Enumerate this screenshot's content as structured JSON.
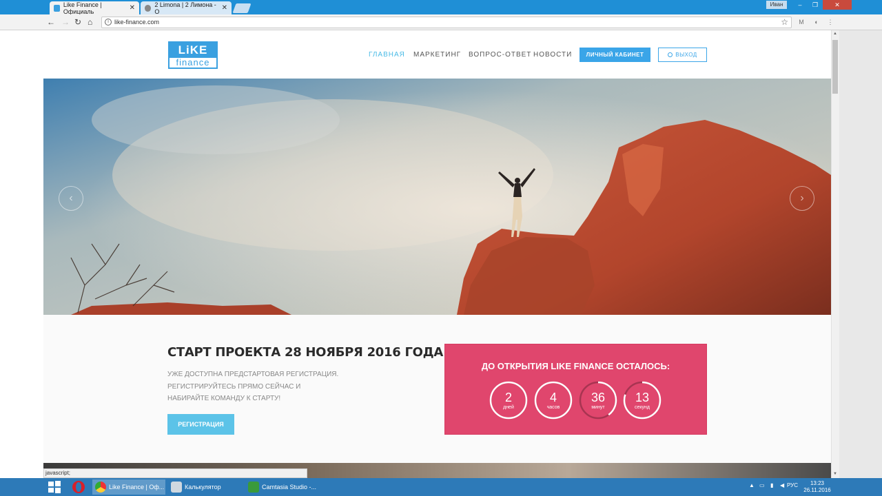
{
  "browser": {
    "tabs": [
      {
        "title": "Like Finance | Официаль",
        "active": true
      },
      {
        "title": "2 Limona | 2 Лимона - О",
        "active": false
      }
    ],
    "user_badge": "Иван",
    "url": "like-finance.com"
  },
  "site": {
    "logo_top": "LiKE",
    "logo_bottom": "finance",
    "nav": [
      "ГЛАВНАЯ",
      "МАРКЕТИНГ",
      "ВОПРОС-ОТВЕТ",
      "НОВОСТИ"
    ],
    "cabinet_label": "ЛИЧНЫЙ КАБИНЕТ",
    "logout_label": "ВЫХОД",
    "accent": "#3aa5e8",
    "nav_active_color": "#4bbbe6"
  },
  "hero": {
    "prev_icon": "chevron-left-icon",
    "next_icon": "chevron-right-icon"
  },
  "start": {
    "title": "СТАРТ ПРОЕКТА 28 НОЯБРЯ 2016 ГОДА",
    "lines": [
      "УЖЕ ДОСТУПНА ПРЕДСТАРТОВАЯ РЕГИСТРАЦИЯ.",
      "РЕГИСТРИРУЙТЕСЬ ПРЯМО СЕЙЧАС И",
      "НАБИРАЙТЕ КОМАНДУ К СТАРТУ!"
    ],
    "register_label": "РЕГИСТРАЦИЯ"
  },
  "countdown": {
    "title": "ДО ОТКРЫТИЯ LIKE FINANCE ОСТАЛОСЬ:",
    "color": "#e0466d",
    "items": [
      {
        "value": "2",
        "label": "дней",
        "fraction": 1.0
      },
      {
        "value": "4",
        "label": "часов",
        "fraction": 1.0
      },
      {
        "value": "36",
        "label": "минут",
        "fraction": 0.4
      },
      {
        "value": "13",
        "label": "секунд",
        "fraction": 0.8
      }
    ]
  },
  "status_text": "javascript;",
  "taskbar": {
    "items": [
      {
        "label": "Like Finance | Оф...",
        "active": true
      },
      {
        "label": "Калькулятор",
        "active": false
      },
      {
        "label": "Camtasia Studio -...",
        "active": false
      }
    ],
    "lang": "РУС",
    "time": "13:23",
    "date": "26.11.2016"
  }
}
